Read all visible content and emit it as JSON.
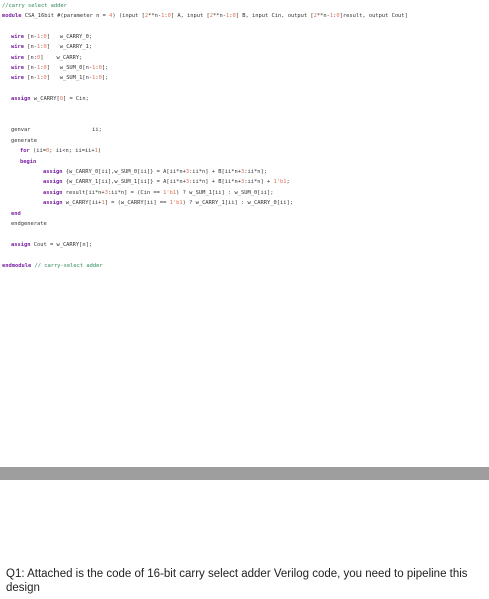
{
  "code": {
    "lines": [
      {
        "indent": 0,
        "parts": [
          {
            "t": "//carry select adder",
            "c": "cm"
          }
        ]
      },
      {
        "indent": 0,
        "parts": [
          {
            "t": "module",
            "c": "kw"
          },
          {
            "t": " CSA_16bit #(parameter n = "
          },
          {
            "t": "4",
            "c": "num"
          },
          {
            "t": ") (input ["
          },
          {
            "t": "2",
            "c": "num"
          },
          {
            "t": "**n-"
          },
          {
            "t": "1",
            "c": "num"
          },
          {
            "t": ":"
          },
          {
            "t": "0",
            "c": "num"
          },
          {
            "t": "] A, input ["
          },
          {
            "t": "2",
            "c": "num"
          },
          {
            "t": "**n-"
          },
          {
            "t": "1",
            "c": "num"
          },
          {
            "t": ":"
          },
          {
            "t": "0",
            "c": "num"
          },
          {
            "t": "] B, input Cin, output ["
          },
          {
            "t": "2",
            "c": "num"
          },
          {
            "t": "**n-"
          },
          {
            "t": "1",
            "c": "num"
          },
          {
            "t": ":"
          },
          {
            "t": "0",
            "c": "num"
          },
          {
            "t": "]result, output Cout]"
          }
        ]
      },
      {
        "indent": 0,
        "parts": []
      },
      {
        "indent": 9,
        "parts": [
          {
            "t": "wire",
            "c": "kw"
          },
          {
            "t": " [n-"
          },
          {
            "t": "1",
            "c": "num"
          },
          {
            "t": ":"
          },
          {
            "t": "0",
            "c": "num"
          },
          {
            "t": "]   w_CARRY_0;"
          }
        ]
      },
      {
        "indent": 9,
        "parts": [
          {
            "t": "wire",
            "c": "kw"
          },
          {
            "t": " [n-"
          },
          {
            "t": "1",
            "c": "num"
          },
          {
            "t": ":"
          },
          {
            "t": "0",
            "c": "num"
          },
          {
            "t": "]   w_CARRY_1;"
          }
        ]
      },
      {
        "indent": 9,
        "parts": [
          {
            "t": "wire",
            "c": "kw"
          },
          {
            "t": " [n:"
          },
          {
            "t": "0",
            "c": "num"
          },
          {
            "t": "]    w_CARRY;"
          }
        ]
      },
      {
        "indent": 9,
        "parts": [
          {
            "t": "wire",
            "c": "kw"
          },
          {
            "t": " [n-"
          },
          {
            "t": "1",
            "c": "num"
          },
          {
            "t": ":"
          },
          {
            "t": "0",
            "c": "num"
          },
          {
            "t": "]   w_SUM_0[n-"
          },
          {
            "t": "1",
            "c": "num"
          },
          {
            "t": ":"
          },
          {
            "t": "0",
            "c": "num"
          },
          {
            "t": "];"
          }
        ]
      },
      {
        "indent": 9,
        "parts": [
          {
            "t": "wire",
            "c": "kw"
          },
          {
            "t": " [n-"
          },
          {
            "t": "1",
            "c": "num"
          },
          {
            "t": ":"
          },
          {
            "t": "0",
            "c": "num"
          },
          {
            "t": "]   w_SUM_1[n-"
          },
          {
            "t": "1",
            "c": "num"
          },
          {
            "t": ":"
          },
          {
            "t": "0",
            "c": "num"
          },
          {
            "t": "];"
          }
        ]
      },
      {
        "indent": 0,
        "parts": []
      },
      {
        "indent": 9,
        "parts": [
          {
            "t": "assign",
            "c": "kw"
          },
          {
            "t": " w_CARRY["
          },
          {
            "t": "0",
            "c": "num"
          },
          {
            "t": "] = Cin;"
          }
        ]
      },
      {
        "indent": 0,
        "parts": []
      },
      {
        "indent": 0,
        "parts": []
      },
      {
        "indent": 9,
        "parts": [
          {
            "t": "genvar                   ii;"
          }
        ]
      },
      {
        "indent": 9,
        "parts": [
          {
            "t": "generate"
          }
        ]
      },
      {
        "indent": 18,
        "parts": [
          {
            "t": "for",
            "c": "kw"
          },
          {
            "t": " (ii="
          },
          {
            "t": "0",
            "c": "num"
          },
          {
            "t": "; ii<n; ii=ii+"
          },
          {
            "t": "1",
            "c": "num"
          },
          {
            "t": ")"
          }
        ]
      },
      {
        "indent": 18,
        "parts": [
          {
            "t": "begin",
            "c": "kw"
          }
        ]
      },
      {
        "indent": 41,
        "parts": [
          {
            "t": "assign",
            "c": "kw"
          },
          {
            "t": " {w_CARRY_0[ii],w_SUM_0[ii]} = A[ii*n+"
          },
          {
            "t": "3",
            "c": "num"
          },
          {
            "t": ":ii*n] + B[ii*n+"
          },
          {
            "t": "3",
            "c": "num"
          },
          {
            "t": ":ii*n];"
          }
        ]
      },
      {
        "indent": 41,
        "parts": [
          {
            "t": "assign",
            "c": "kw"
          },
          {
            "t": " {w_CARRY_1[ii],w_SUM_1[ii]} = A[ii*n+"
          },
          {
            "t": "3",
            "c": "num"
          },
          {
            "t": ":ii*n] + B[ii*n+"
          },
          {
            "t": "3",
            "c": "num"
          },
          {
            "t": ":ii*n] + "
          },
          {
            "t": "1'b1",
            "c": "num"
          },
          {
            "t": ";"
          }
        ]
      },
      {
        "indent": 41,
        "parts": [
          {
            "t": "assign",
            "c": "kw"
          },
          {
            "t": " result[ii*n+"
          },
          {
            "t": "3",
            "c": "num"
          },
          {
            "t": ":ii*n] = (Cin == "
          },
          {
            "t": "1'b1",
            "c": "num"
          },
          {
            "t": ") ? w_SUM_1[ii] : w_SUM_0[ii];"
          }
        ]
      },
      {
        "indent": 41,
        "parts": [
          {
            "t": "assign",
            "c": "kw"
          },
          {
            "t": " w_CARRY[ii+"
          },
          {
            "t": "1",
            "c": "num"
          },
          {
            "t": "] = (w_CARRY[ii] == "
          },
          {
            "t": "1'b1",
            "c": "num"
          },
          {
            "t": ") ? w_CARRY_1[ii] : w_CARRY_0[ii];"
          }
        ]
      },
      {
        "indent": 9,
        "parts": [
          {
            "t": "end",
            "c": "kw"
          }
        ]
      },
      {
        "indent": 9,
        "parts": [
          {
            "t": "endgenerate"
          }
        ]
      },
      {
        "indent": 0,
        "parts": []
      },
      {
        "indent": 9,
        "parts": [
          {
            "t": "assign",
            "c": "kw"
          },
          {
            "t": " Cout = w_CARRY[n];"
          }
        ]
      },
      {
        "indent": 0,
        "parts": []
      },
      {
        "indent": 0,
        "parts": [
          {
            "t": "endmodule",
            "c": "kw"
          },
          {
            "t": " "
          },
          {
            "t": "// carry-select adder",
            "c": "cm"
          }
        ]
      }
    ]
  },
  "question": {
    "text": "Q1: Attached is the code of 16-bit carry select adder Verilog code, you need to pipeline this design"
  }
}
